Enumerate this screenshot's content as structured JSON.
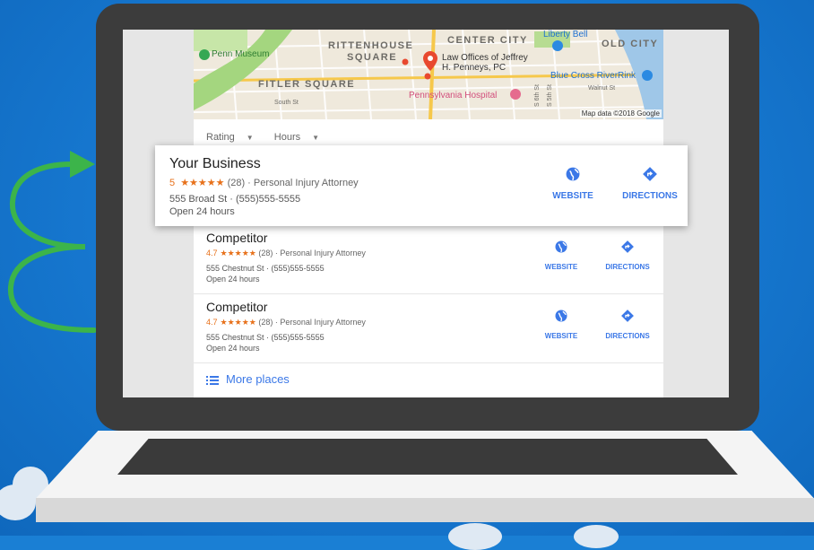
{
  "colors": {
    "background": "#1a7fd4",
    "laptop_bezel": "#3c3c3c",
    "accent_blue": "#3b78e7",
    "star_orange": "#e7711b",
    "arrow_green": "#3cb44a"
  },
  "map": {
    "labels": {
      "rittenhouse_1": "RITTENHOUSE",
      "rittenhouse_2": "SQUARE",
      "center_city": "CENTER CITY",
      "old_city": "OLD CITY",
      "liberty_bell": "Liberty Bell",
      "penn_museum": "Penn Museum",
      "fitler_square": "FITLER SQUARE",
      "law_office_1": "Law Offices of Jeffrey",
      "law_office_2": "H. Penneys, PC",
      "blue_cross": "Blue Cross RiverRink",
      "pennsylvania_hospital": "Pennsylvania Hospital",
      "walnut_st": "Walnut St",
      "south_st": "South St",
      "sixth_st": "S 6th St",
      "fifth_st": "S 5th St"
    },
    "credit": "Map data ©2018 Google"
  },
  "filters": [
    "Rating",
    "Hours"
  ],
  "featured": {
    "name": "Your Business",
    "rating": "5",
    "stars": "★★★★★",
    "reviews_and_category": "(28) · Personal Injury Attorney",
    "address": "555  Broad St · (555)555-5555",
    "hours": "Open 24 hours",
    "website_label": "WEBSITE",
    "directions_label": "DIRECTIONS"
  },
  "competitors": [
    {
      "name": "Competitor",
      "rating": "4.7",
      "stars": "★★★★★",
      "reviews_and_category": "(28) · Personal Injury Attorney",
      "address": "555  Chestnut St · (555)555-5555",
      "hours": "Open 24 hours",
      "website_label": "WEBSITE",
      "directions_label": "DIRECTIONS"
    },
    {
      "name": "Competitor",
      "rating": "4.7",
      "stars": "★★★★★",
      "reviews_and_category": "(28) · Personal Injury Attorney",
      "address": "555  Chestnut St · (555)555-5555",
      "hours": "Open 24 hours",
      "website_label": "WEBSITE",
      "directions_label": "DIRECTIONS"
    }
  ],
  "more_places": "More places",
  "icons": {
    "website": "globe-icon",
    "directions": "directions-icon",
    "list": "list-icon",
    "arrow": "green-curved-arrow-icon"
  }
}
